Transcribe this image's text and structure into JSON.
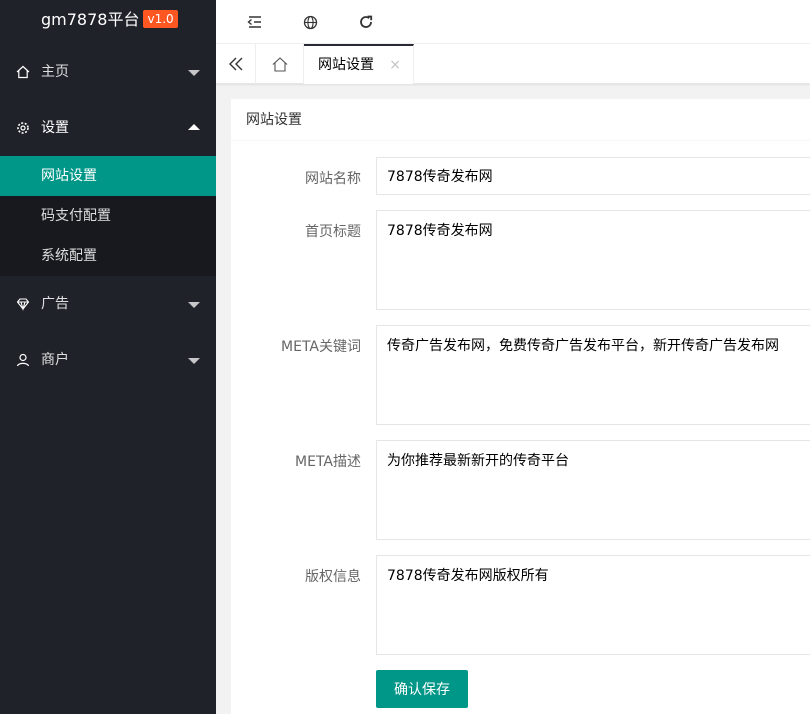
{
  "sidebar": {
    "logo": "gm7878平台",
    "version": "v1.0",
    "items": [
      {
        "label": "主页",
        "icon": "home-icon"
      },
      {
        "label": "设置",
        "icon": "gear-icon"
      },
      {
        "label": "广告",
        "icon": "diamond-icon"
      },
      {
        "label": "商户",
        "icon": "user-icon"
      }
    ],
    "settings_sub": [
      {
        "label": "网站设置",
        "active": true
      },
      {
        "label": "码支付配置"
      },
      {
        "label": "系统配置"
      }
    ]
  },
  "header": {
    "icons": [
      "menu-collapse-icon",
      "globe-icon",
      "refresh-icon"
    ]
  },
  "tabs": {
    "active_label": "网站设置",
    "close": "×"
  },
  "form": {
    "title": "网站设置",
    "fields": [
      {
        "label": "网站名称",
        "value": "7878传奇发布网"
      },
      {
        "label": "首页标题",
        "value": "7878传奇发布网"
      },
      {
        "label": "META关键词",
        "value": "传奇广告发布网，免费传奇广告发布平台，新开传奇广告发布网"
      },
      {
        "label": "META描述",
        "value": "为你推荐最新新开的传奇平台"
      },
      {
        "label": "版权信息",
        "value": "7878传奇发布网版权所有"
      }
    ],
    "save_label": "确认保存"
  },
  "colors": {
    "sidebar_bg": "#20222a",
    "accent": "#009688",
    "version_badge": "#ff5722"
  }
}
